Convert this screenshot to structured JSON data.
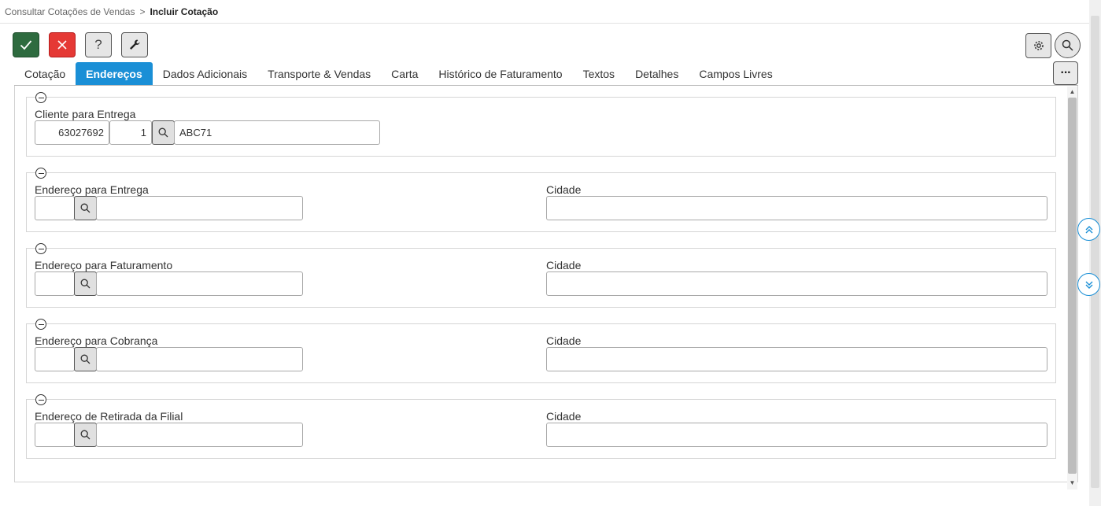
{
  "breadcrumb": {
    "parent": "Consultar Cotações de Vendas",
    "separator": ">",
    "current": "Incluir Cotação"
  },
  "toolbar": {
    "buttons": [
      {
        "name": "confirm",
        "icon": "check-icon",
        "color": "#2e6b3f"
      },
      {
        "name": "cancel",
        "icon": "close-icon",
        "color": "#e53935"
      },
      {
        "name": "help",
        "icon": "question-icon",
        "label": "?"
      },
      {
        "name": "tools",
        "icon": "wrench-icon"
      }
    ],
    "right": [
      "gear-icon",
      "search-icon"
    ]
  },
  "tabs": [
    {
      "label": "Cotação",
      "active": false
    },
    {
      "label": "Endereços",
      "active": true
    },
    {
      "label": "Dados Adicionais",
      "active": false
    },
    {
      "label": "Transporte & Vendas",
      "active": false
    },
    {
      "label": "Carta",
      "active": false
    },
    {
      "label": "Histórico de Faturamento",
      "active": false
    },
    {
      "label": "Textos",
      "active": false
    },
    {
      "label": "Detalhes",
      "active": false
    },
    {
      "label": "Campos Livres",
      "active": false
    }
  ],
  "more_label": "···",
  "accent_color": "#1a8fd6",
  "client": {
    "label": "Cliente para Entrega",
    "code": "63027692",
    "seq": "1",
    "name": "ABC71"
  },
  "addresses": [
    {
      "label": "Endereço para Entrega",
      "code": "",
      "desc": "",
      "city_label": "Cidade",
      "city": ""
    },
    {
      "label": "Endereço para Faturamento",
      "code": "",
      "desc": "",
      "city_label": "Cidade",
      "city": ""
    },
    {
      "label": "Endereço para Cobrança",
      "code": "",
      "desc": "",
      "city_label": "Cidade",
      "city": ""
    },
    {
      "label": "Endereço de Retirada da Filial",
      "code": "",
      "desc": "",
      "city_label": "Cidade",
      "city": ""
    }
  ]
}
